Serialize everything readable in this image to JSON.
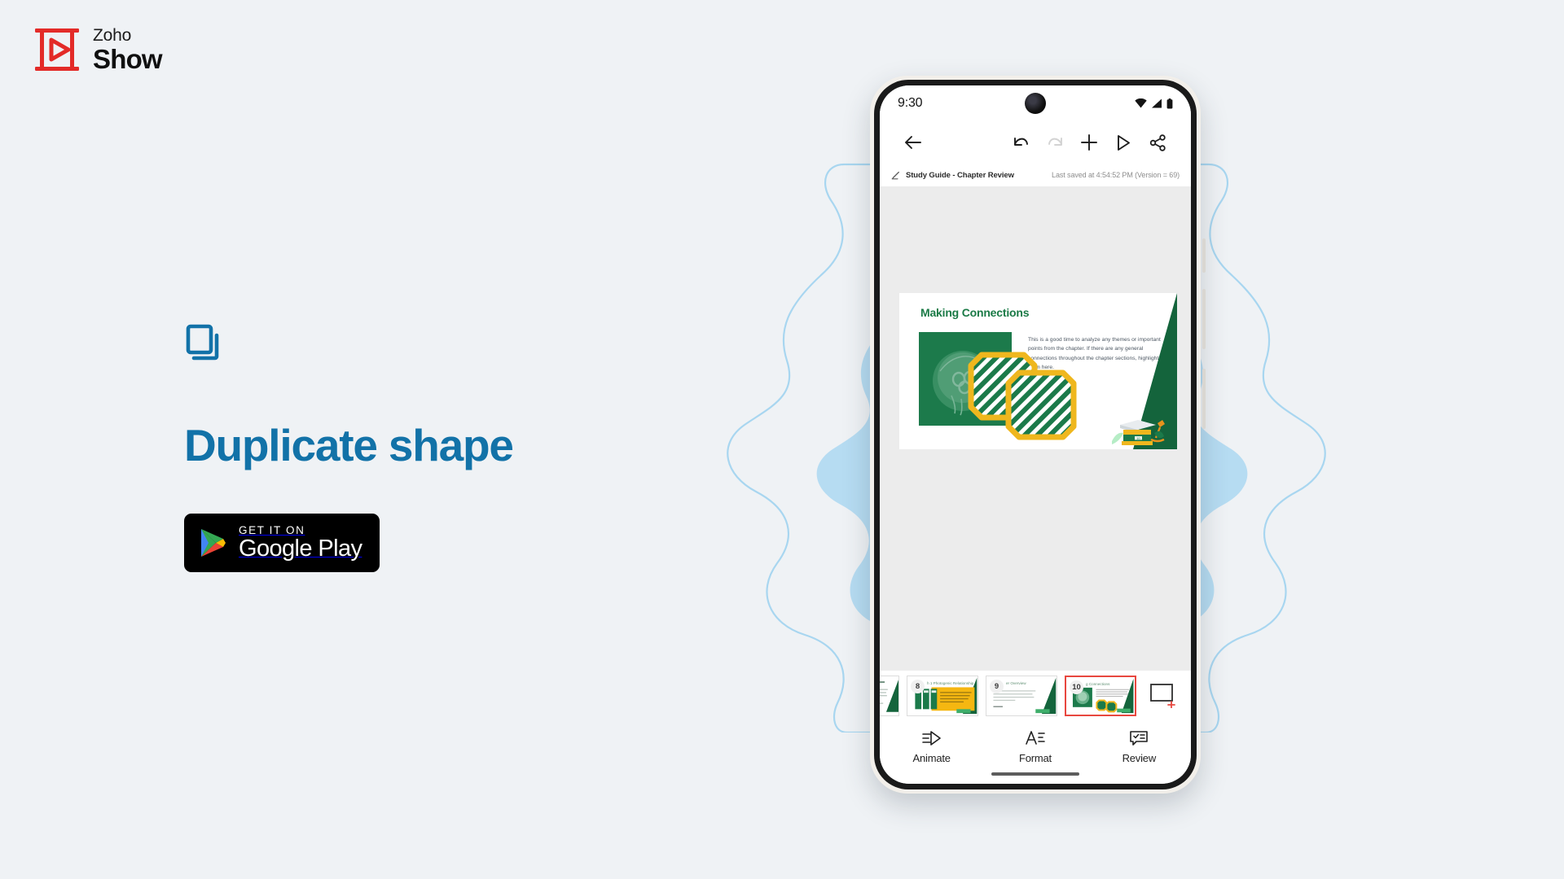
{
  "brand": {
    "name_top": "Zoho",
    "name_bottom": "Show",
    "logo_icon": "zoho-show-play-logo-icon",
    "logo_color": "#e32b28"
  },
  "hero": {
    "feature_icon": "duplicate-shape-icon",
    "title": "Duplicate shape",
    "accent_color": "#1272a8",
    "store_badge": {
      "icon": "google-play-triangle-icon",
      "line1": "GET IT ON",
      "line2": "Google Play"
    }
  },
  "background": {
    "page_color": "#eff2f5",
    "blob_fill": "#b6dcf2",
    "blob_stroke": "#a8d6f0"
  },
  "phone": {
    "statusbar": {
      "time": "9:30",
      "icons": [
        "wifi-icon",
        "cellular-signal-icon",
        "battery-icon"
      ],
      "camera": "punch-hole-camera"
    },
    "toolbar": {
      "back": "back-arrow-icon",
      "undo": "undo-icon",
      "redo": "redo-icon",
      "redo_disabled": true,
      "add": "plus-icon",
      "present": "play-present-icon",
      "share": "share-icon"
    },
    "docbar": {
      "edit_icon": "pencil-edit-icon",
      "title": "Study Guide - Chapter Review",
      "saved_status": "Last saved at 4:54:52 PM (Version = 69)"
    },
    "slide": {
      "title": "Making Connections",
      "body": "This is a good time to analyze any themes or important points from the chapter. If there are any general connections throughout the chapter sections, highlight them here.",
      "photo": "jellyfish-green-photo",
      "decor": "green-triangle-decor",
      "illustration": "books-microscope-illustration",
      "shapes": [
        {
          "name": "octagon-shape-original",
          "fill": "#1b7a4a",
          "stripe": "#ffffff",
          "border": "#efb71e"
        },
        {
          "name": "octagon-shape-duplicate",
          "fill": "#1b7a4a",
          "stripe": "#ffffff",
          "border": "#efb71e"
        }
      ]
    },
    "thumbnails": [
      {
        "number": "",
        "title": "",
        "selected": false,
        "partial": true
      },
      {
        "number": "8",
        "title": "h 1 Photogenic Relationship",
        "selected": false
      },
      {
        "number": "9",
        "title": "er Overview",
        "selected": false
      },
      {
        "number": "10",
        "title": "g Connections",
        "selected": true
      }
    ],
    "add_slide_icon": "add-slide-icon",
    "bottomnav": [
      {
        "label": "Animate",
        "icon": "animate-icon"
      },
      {
        "label": "Format",
        "icon": "format-text-icon"
      },
      {
        "label": "Review",
        "icon": "review-comment-icon"
      }
    ],
    "home_indicator": "home-gesture-bar"
  }
}
